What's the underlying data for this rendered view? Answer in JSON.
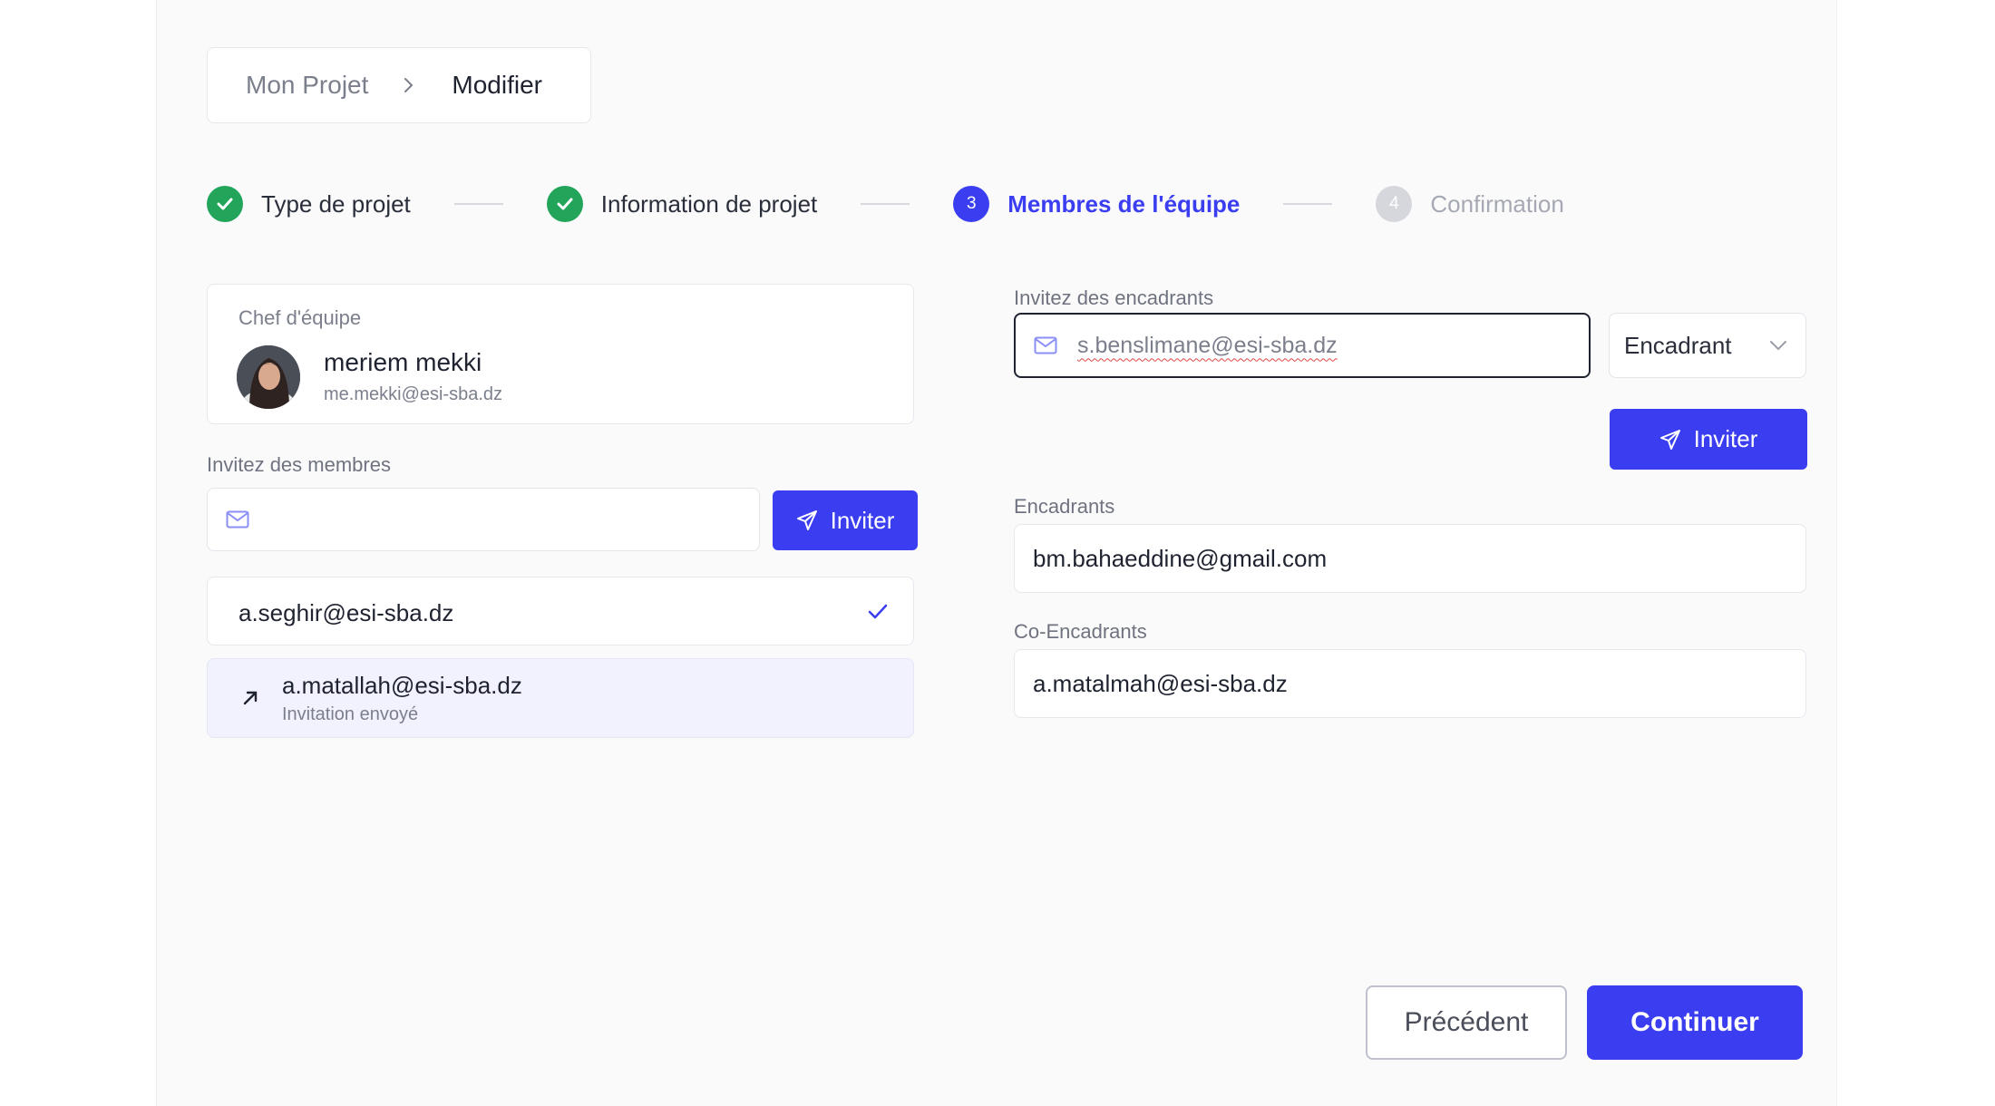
{
  "breadcrumb": {
    "parent": "Mon Projet",
    "current": "Modifier"
  },
  "stepper": {
    "steps": [
      {
        "label": "Type de projet",
        "state": "done"
      },
      {
        "label": "Information de projet",
        "state": "done"
      },
      {
        "label": "Membres de l'équipe",
        "number": "3",
        "state": "active"
      },
      {
        "label": "Confirmation",
        "number": "4",
        "state": "pending"
      }
    ]
  },
  "chef": {
    "title": "Chef d'équipe",
    "name": "meriem mekki",
    "email": "me.mekki@esi-sba.dz"
  },
  "members": {
    "label": "Invitez des membres",
    "input_value": "",
    "invite_label": "Inviter",
    "list": [
      {
        "email": "a.seghir@esi-sba.dz",
        "status": ""
      },
      {
        "email": "a.matallah@esi-sba.dz",
        "status": "Invitation envoyé"
      }
    ]
  },
  "supervisors": {
    "label": "Invitez des encadrants",
    "input_value": "s.benslimane@esi-sba.dz",
    "role_selected": "Encadrant",
    "invite_label": "Inviter",
    "encadrants_label": "Encadrants",
    "encadrants_value": "bm.bahaeddine@gmail.com",
    "co_label": "Co-Encadrants",
    "co_value": "a.matalmah@esi-sba.dz"
  },
  "actions": {
    "previous": "Précédent",
    "continue": "Continuer"
  },
  "colors": {
    "primary": "#3b3ef0",
    "success": "#22a55b",
    "pending": "#d6d7dd"
  }
}
